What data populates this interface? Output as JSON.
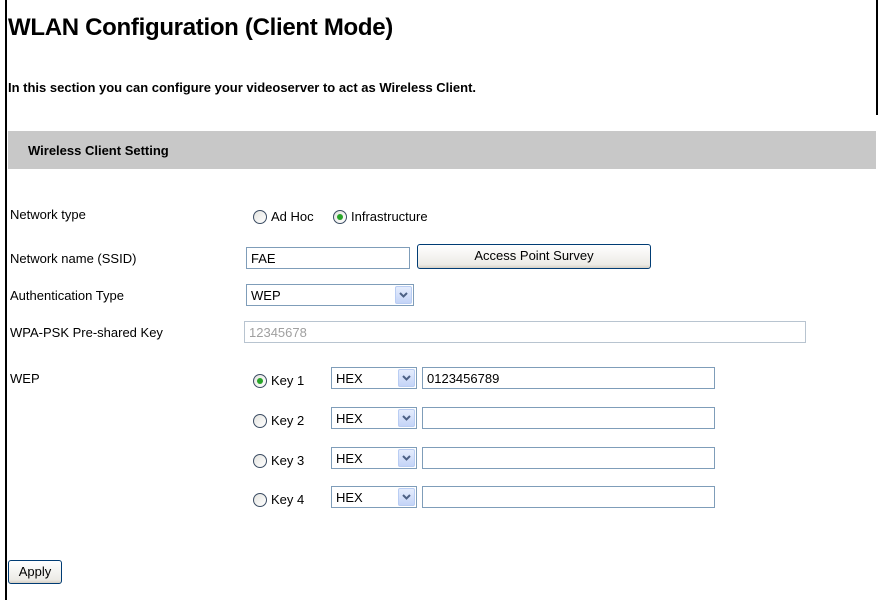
{
  "page": {
    "title": "WLAN Configuration (Client Mode)",
    "intro": "In this section you can configure your videoserver to act as Wireless Client."
  },
  "section": {
    "header": "Wireless Client Setting"
  },
  "network_type": {
    "label": "Network type",
    "options": [
      "Ad Hoc",
      "Infrastructure"
    ],
    "selected": "Infrastructure"
  },
  "ssid": {
    "label": "Network name (SSID)",
    "value": "FAE",
    "survey_button": "Access Point Survey"
  },
  "auth": {
    "label": "Authentication Type",
    "value": "WEP"
  },
  "wpa": {
    "label": "WPA-PSK Pre-shared Key",
    "value": "12345678",
    "disabled": true
  },
  "wep": {
    "label": "WEP",
    "selected_key": "Key 1",
    "keys": [
      {
        "label": "Key 1",
        "format": "HEX",
        "value": "0123456789"
      },
      {
        "label": "Key 2",
        "format": "HEX",
        "value": ""
      },
      {
        "label": "Key 3",
        "format": "HEX",
        "value": ""
      },
      {
        "label": "Key 4",
        "format": "HEX",
        "value": ""
      }
    ]
  },
  "apply_button": "Apply",
  "icons": {
    "dropdown": "chevron-down-icon",
    "radio": "radio-button"
  },
  "colors": {
    "section_header_bg": "#c8c8c8",
    "radio_checked_dot": "#28a428",
    "field_border": "#7f9db9"
  }
}
